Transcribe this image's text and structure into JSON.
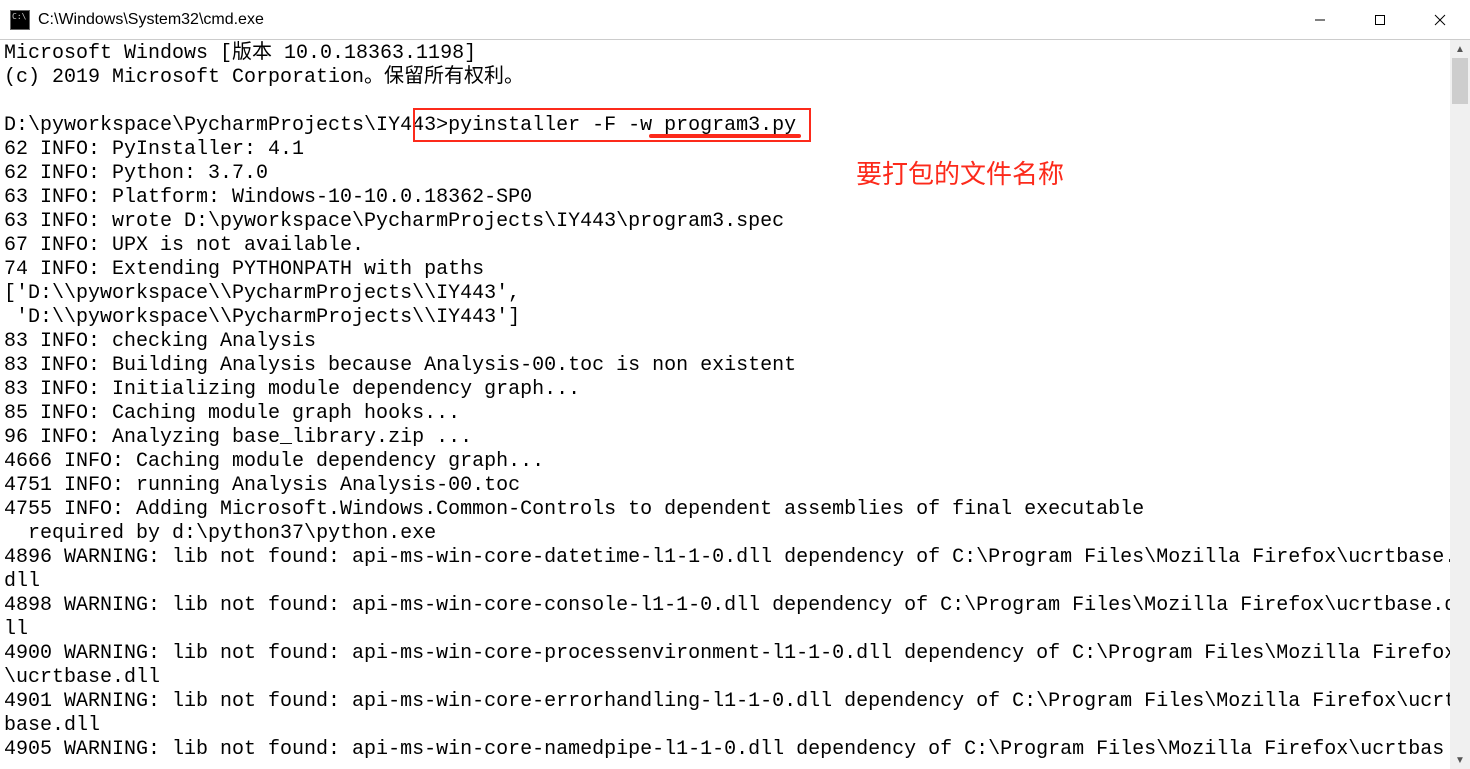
{
  "window": {
    "title": "C:\\Windows\\System32\\cmd.exe"
  },
  "annotation": {
    "label": "要打包的文件名称"
  },
  "terminal": {
    "line0": "Microsoft Windows [版本 10.0.18363.1198]",
    "line1": "(c) 2019 Microsoft Corporation。保留所有权利。",
    "blank1": "",
    "prompt": "D:\\pyworkspace\\PycharmProjects\\IY443>",
    "command": "pyinstaller -F -w program3.py",
    "out0": "62 INFO: PyInstaller: 4.1",
    "out1": "62 INFO: Python: 3.7.0",
    "out2": "63 INFO: Platform: Windows-10-10.0.18362-SP0",
    "out3": "63 INFO: wrote D:\\pyworkspace\\PycharmProjects\\IY443\\program3.spec",
    "out4": "67 INFO: UPX is not available.",
    "out5": "74 INFO: Extending PYTHONPATH with paths",
    "out6": "['D:\\\\pyworkspace\\\\PycharmProjects\\\\IY443',",
    "out7": " 'D:\\\\pyworkspace\\\\PycharmProjects\\\\IY443']",
    "out8": "83 INFO: checking Analysis",
    "out9": "83 INFO: Building Analysis because Analysis-00.toc is non existent",
    "out10": "83 INFO: Initializing module dependency graph...",
    "out11": "85 INFO: Caching module graph hooks...",
    "out12": "96 INFO: Analyzing base_library.zip ...",
    "out13": "4666 INFO: Caching module dependency graph...",
    "out14": "4751 INFO: running Analysis Analysis-00.toc",
    "out15": "4755 INFO: Adding Microsoft.Windows.Common-Controls to dependent assemblies of final executable",
    "out16": "  required by d:\\python37\\python.exe",
    "out17": "4896 WARNING: lib not found: api-ms-win-core-datetime-l1-1-0.dll dependency of C:\\Program Files\\Mozilla Firefox\\ucrtbase.dll",
    "out18": "4898 WARNING: lib not found: api-ms-win-core-console-l1-1-0.dll dependency of C:\\Program Files\\Mozilla Firefox\\ucrtbase.dll",
    "out19": "4900 WARNING: lib not found: api-ms-win-core-processenvironment-l1-1-0.dll dependency of C:\\Program Files\\Mozilla Firefox\\ucrtbase.dll",
    "out20": "4901 WARNING: lib not found: api-ms-win-core-errorhandling-l1-1-0.dll dependency of C:\\Program Files\\Mozilla Firefox\\ucrtbase.dll",
    "out21": "4905 WARNING: lib not found: api-ms-win-core-namedpipe-l1-1-0.dll dependency of C:\\Program Files\\Mozilla Firefox\\ucrtbas"
  }
}
